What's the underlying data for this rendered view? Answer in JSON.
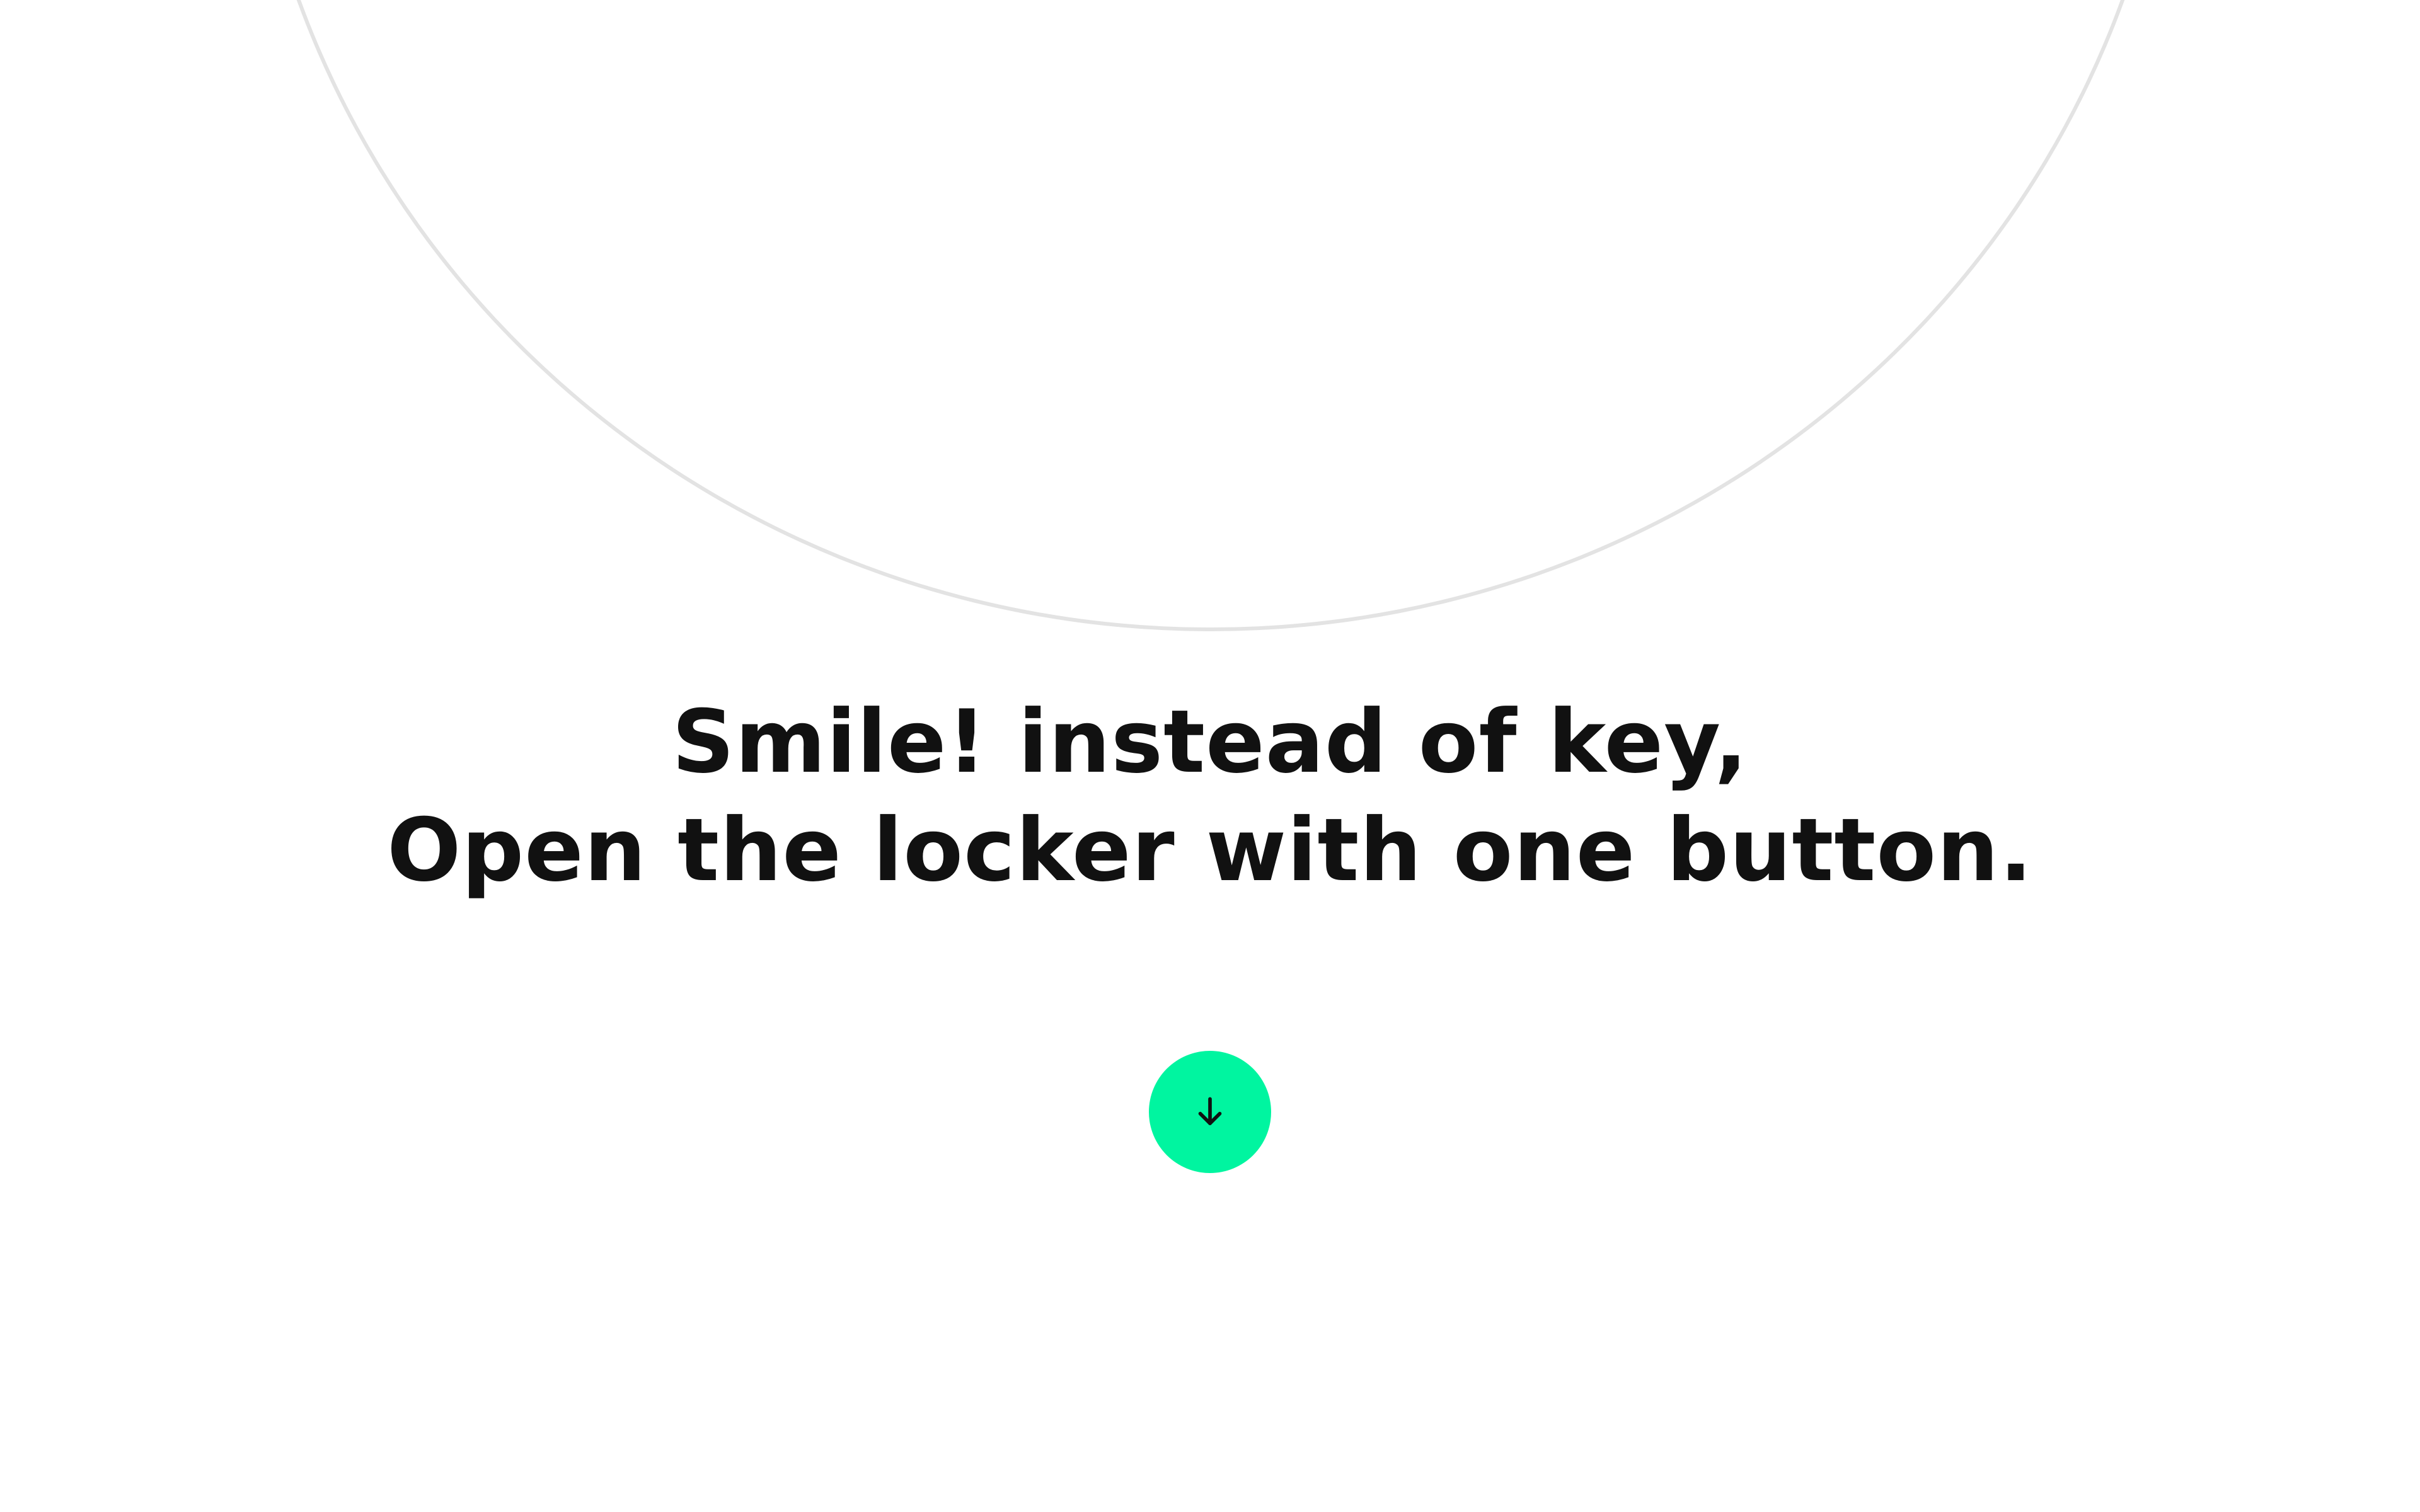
{
  "hero": {
    "headline_line1": "Smile! instead of key,",
    "headline_line2": "Open the locker with one button."
  },
  "scroll_button": {
    "icon": "arrow-down-icon",
    "color": "#00f5a0",
    "icon_color": "#111111"
  },
  "colors": {
    "background": "#ffffff",
    "ring": "#e3e3e3",
    "text": "#111111"
  }
}
